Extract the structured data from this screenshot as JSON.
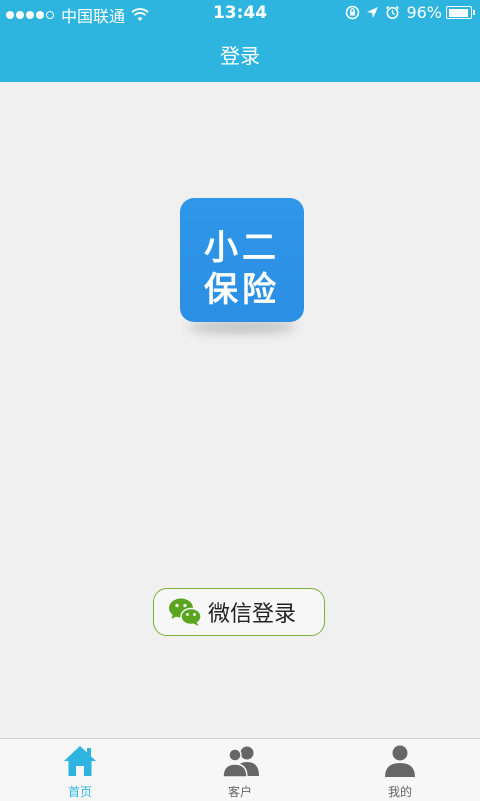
{
  "status_bar": {
    "carrier": "中国联通",
    "time": "13:44",
    "battery": "96%"
  },
  "header": {
    "title": "登录"
  },
  "logo": {
    "line1": "小二",
    "line2": "保险"
  },
  "login": {
    "wechat_label": "微信登录"
  },
  "tabs": [
    {
      "label": "首页",
      "icon": "home-icon",
      "active": true
    },
    {
      "label": "客户",
      "icon": "users-icon",
      "active": false
    },
    {
      "label": "我的",
      "icon": "user-icon",
      "active": false
    }
  ],
  "colors": {
    "accent": "#2db5e0",
    "logo_blue": "#2f96e8",
    "wechat_green": "#7bb13a",
    "background": "#f0f0f0"
  }
}
